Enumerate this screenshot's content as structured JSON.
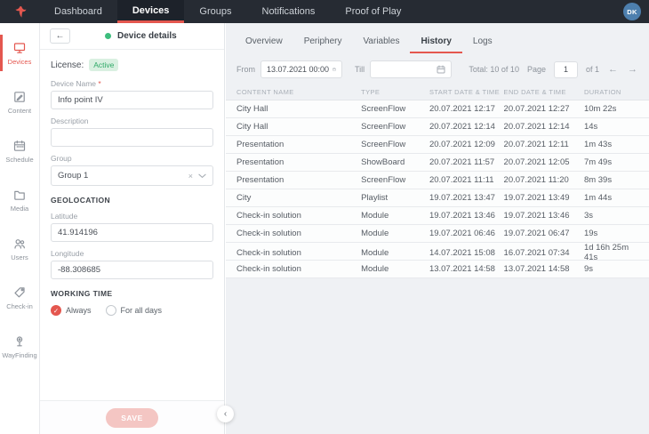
{
  "colors": {
    "accent": "#e4574f",
    "nav_bg": "#262b33",
    "online_green": "#3dbd7d",
    "avatar_blue": "#4d7fae",
    "badge_green_bg": "#d9f0e1"
  },
  "topnav": {
    "items": [
      {
        "label": "Dashboard"
      },
      {
        "label": "Devices"
      },
      {
        "label": "Groups"
      },
      {
        "label": "Notifications"
      },
      {
        "label": "Proof of Play"
      }
    ],
    "avatar": "DK"
  },
  "sidebar": {
    "items": [
      {
        "label": "Devices"
      },
      {
        "label": "Content"
      },
      {
        "label": "Schedule"
      },
      {
        "label": "Media"
      },
      {
        "label": "Users"
      },
      {
        "label": "Check-in"
      },
      {
        "label": "WayFinding"
      }
    ]
  },
  "panel": {
    "title": "Device details",
    "license_label": "License:",
    "license_status": "Active",
    "device_name": {
      "label": "Device Name",
      "required_mark": "*",
      "value": "Info point IV"
    },
    "description": {
      "label": "Description",
      "value": ""
    },
    "group": {
      "label": "Group",
      "value": "Group 1"
    },
    "geolocation_header": "GEOLOCATION",
    "latitude": {
      "label": "Latitude",
      "value": "41.914196"
    },
    "longitude": {
      "label": "Longitude",
      "value": "-88.308685"
    },
    "working_time_header": "WORKING TIME",
    "working_time_options": [
      {
        "label": "Always",
        "checked": true
      },
      {
        "label": "For all days",
        "checked": false
      }
    ],
    "save_label": "SAVE"
  },
  "tabs": {
    "items": [
      {
        "label": "Overview"
      },
      {
        "label": "Periphery"
      },
      {
        "label": "Variables"
      },
      {
        "label": "History"
      },
      {
        "label": "Logs"
      }
    ],
    "active": "History"
  },
  "filters": {
    "from_label": "From",
    "from_value": "13.07.2021 00:00",
    "till_label": "Till",
    "till_value": ""
  },
  "pagination": {
    "total": "Total: 10 of 10",
    "page_label": "Page",
    "page_value": "1",
    "of_label": "of 1",
    "prev": "←",
    "next": "→"
  },
  "history": {
    "columns": [
      "CONTENT NAME",
      "TYPE",
      "START DATE & TIME",
      "END DATE & TIME",
      "DURATION"
    ],
    "rows": [
      {
        "name": "City Hall",
        "type": "ScreenFlow",
        "start": "20.07.2021 12:17",
        "end": "20.07.2021 12:27",
        "duration": "10m 22s"
      },
      {
        "name": "City Hall",
        "type": "ScreenFlow",
        "start": "20.07.2021 12:14",
        "end": "20.07.2021 12:14",
        "duration": "14s"
      },
      {
        "name": "Presentation",
        "type": "ScreenFlow",
        "start": "20.07.2021 12:09",
        "end": "20.07.2021 12:11",
        "duration": "1m 43s"
      },
      {
        "name": "Presentation",
        "type": "ShowBoard",
        "start": "20.07.2021 11:57",
        "end": "20.07.2021 12:05",
        "duration": "7m 49s"
      },
      {
        "name": "Presentation",
        "type": "ScreenFlow",
        "start": "20.07.2021 11:11",
        "end": "20.07.2021 11:20",
        "duration": "8m 39s"
      },
      {
        "name": "City",
        "type": "Playlist",
        "start": "19.07.2021 13:47",
        "end": "19.07.2021 13:49",
        "duration": "1m 44s"
      },
      {
        "name": "Check-in solution",
        "type": "Module",
        "start": "19.07.2021 13:46",
        "end": "19.07.2021 13:46",
        "duration": "3s"
      },
      {
        "name": "Check-in solution",
        "type": "Module",
        "start": "19.07.2021 06:46",
        "end": "19.07.2021 06:47",
        "duration": "19s"
      },
      {
        "name": "Check-in solution",
        "type": "Module",
        "start": "14.07.2021 15:08",
        "end": "16.07.2021 07:34",
        "duration": "1d 16h 25m 41s"
      },
      {
        "name": "Check-in solution",
        "type": "Module",
        "start": "13.07.2021 14:58",
        "end": "13.07.2021 14:58",
        "duration": "9s"
      }
    ]
  }
}
